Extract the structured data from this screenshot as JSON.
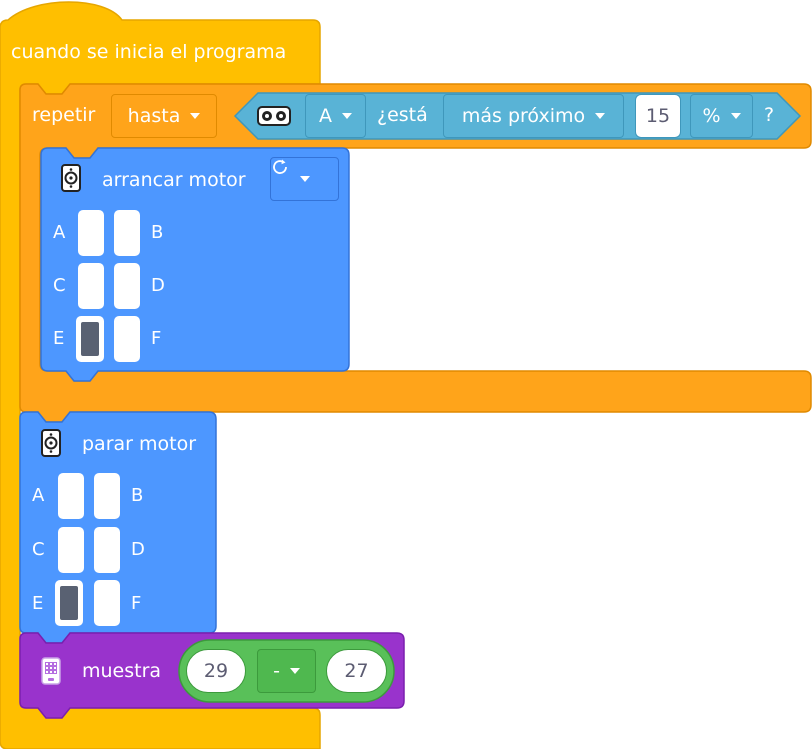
{
  "hat": {
    "label": "cuando se inicia el programa"
  },
  "repeat": {
    "label": "repetir",
    "mode": "hasta",
    "condition": {
      "sensor_icon": "distance-sensor-icon",
      "port": "A",
      "verb": "¿está",
      "comparison": "más próximo",
      "value": "15",
      "unit": "%",
      "question": "?"
    }
  },
  "start_motor": {
    "icon": "motor-icon",
    "label": "arrancar motor",
    "direction_icon": "clockwise-arrow-icon",
    "ports": [
      {
        "letter": "A",
        "selected": false
      },
      {
        "letter": "B",
        "selected": false
      },
      {
        "letter": "C",
        "selected": false
      },
      {
        "letter": "D",
        "selected": false
      },
      {
        "letter": "E",
        "selected": true
      },
      {
        "letter": "F",
        "selected": false
      }
    ]
  },
  "stop_motor": {
    "icon": "motor-icon",
    "label": "parar motor",
    "ports": [
      {
        "letter": "A",
        "selected": false
      },
      {
        "letter": "B",
        "selected": false
      },
      {
        "letter": "C",
        "selected": false
      },
      {
        "letter": "D",
        "selected": false
      },
      {
        "letter": "E",
        "selected": true
      },
      {
        "letter": "F",
        "selected": false
      }
    ]
  },
  "display": {
    "icon": "light-matrix-icon",
    "label": "muestra",
    "left": "29",
    "operator": "-",
    "right": "27"
  },
  "colors": {
    "events": "#ffcc00",
    "control": "#ffa41a",
    "sensors": "#59b3d6",
    "motors": "#4d97ff",
    "display": "#9933cc",
    "operators": "#59c059"
  }
}
